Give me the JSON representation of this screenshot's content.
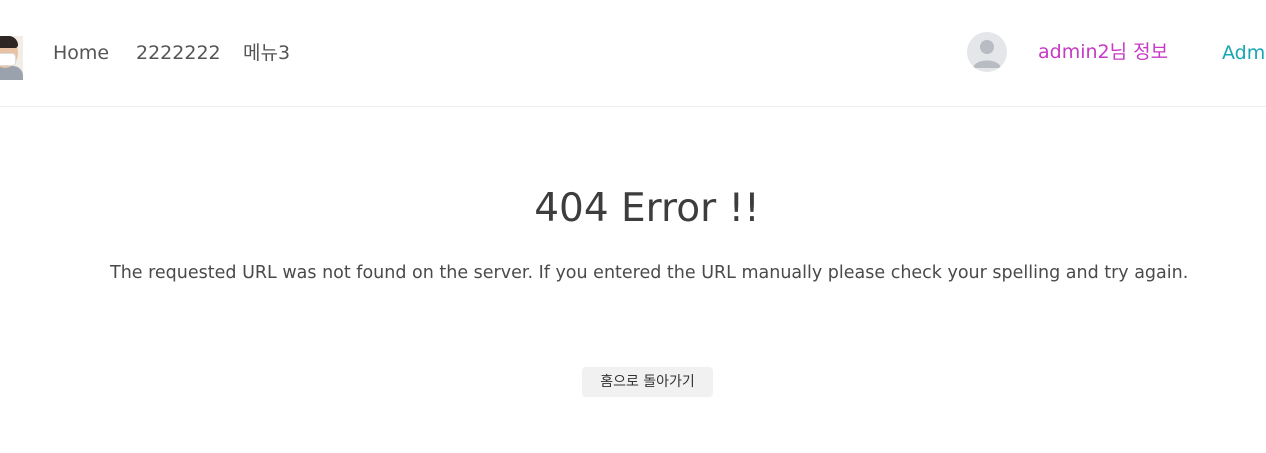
{
  "navbar": {
    "logo_alt": "profile photo",
    "links": [
      {
        "label": "Home"
      },
      {
        "label": "2222222"
      },
      {
        "label": "메뉴3"
      }
    ],
    "user_avatar_icon": "user-silhouette-icon",
    "user_info_label": "admin2님 정보",
    "admin_label": "Admi",
    "colors": {
      "user_info": "#c63ac6",
      "admin": "#1aa5b3",
      "border": "#efefef"
    }
  },
  "main": {
    "title": "404 Error !!",
    "message": "The requested URL was not found on the server. If you entered the URL manually please check your spelling and try again.",
    "home_button_label": "홈으로 돌아가기"
  }
}
